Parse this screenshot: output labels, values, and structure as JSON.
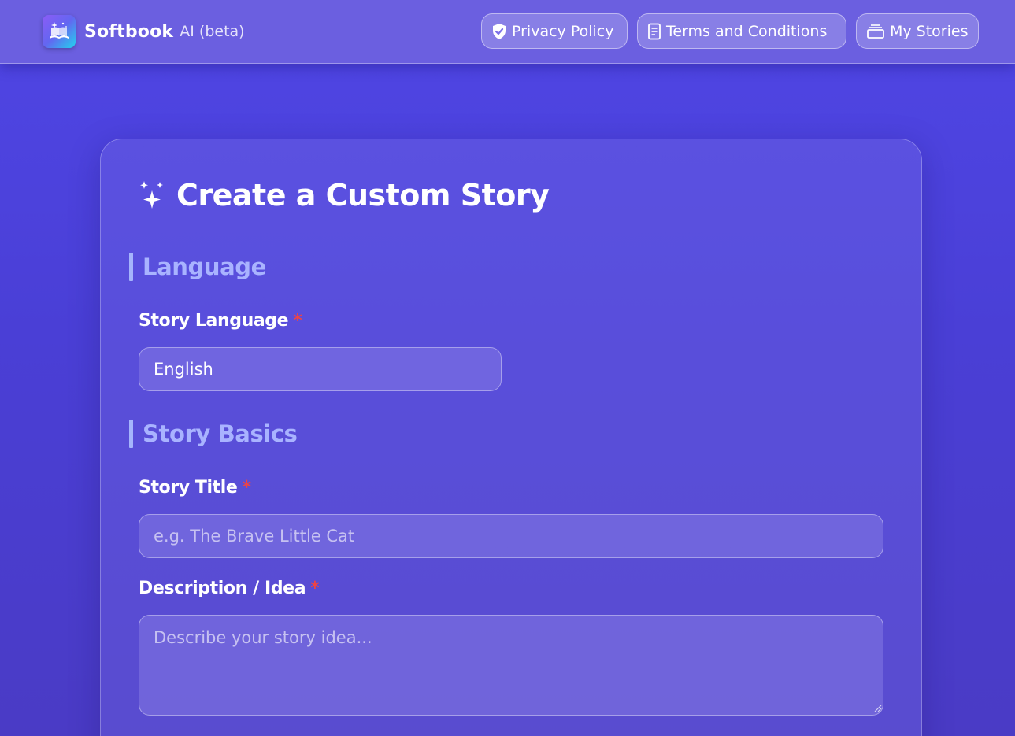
{
  "header": {
    "brand_name": "Softbook",
    "brand_sub": "AI (beta)",
    "logo_icon": "open-book-sparkle-icon",
    "nav": [
      {
        "label": "Privacy Policy",
        "icon": "shield-icon"
      },
      {
        "label": "Terms and Conditions",
        "icon": "document-icon"
      },
      {
        "label": "My Stories",
        "icon": "stack-icon"
      }
    ]
  },
  "form": {
    "title": "Create a Custom Story",
    "title_icon": "sparkles-icon",
    "sections": [
      {
        "heading": "Language"
      },
      {
        "heading": "Story Basics"
      }
    ],
    "fields": {
      "language": {
        "label": "Story Language",
        "required_mark": "*",
        "value": "English"
      },
      "title": {
        "label": "Story Title",
        "required_mark": "*",
        "value": "",
        "placeholder": "e.g. The Brave Little Cat"
      },
      "description": {
        "label": "Description / Idea",
        "required_mark": "*",
        "value": "",
        "placeholder": "Describe your story idea..."
      }
    }
  },
  "colors": {
    "background": "#4f46e5",
    "accent_heading": "#a9b3ff",
    "required": "#ef4444"
  }
}
